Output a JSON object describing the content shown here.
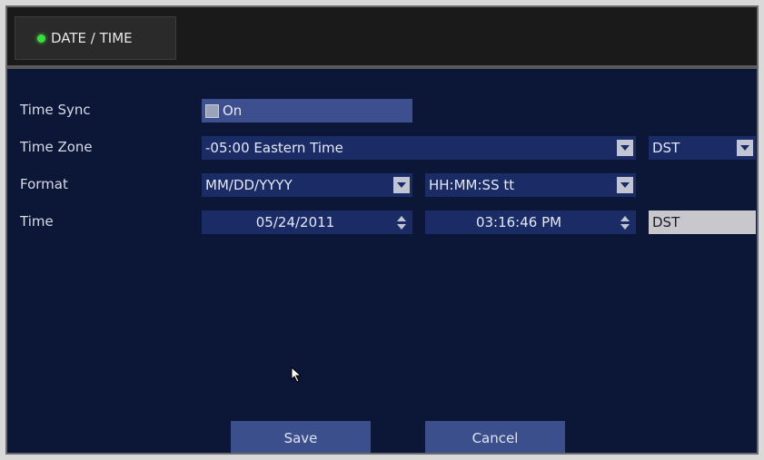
{
  "header": {
    "title": "DATE / TIME",
    "status_color": "#3ddc3d"
  },
  "rows": {
    "time_sync": {
      "label": "Time Sync",
      "checkbox_icon": "checkbox-icon",
      "value": "On"
    },
    "time_zone": {
      "label": "Time Zone",
      "value": "-05:00 Eastern Time",
      "dst_value": "DST"
    },
    "format": {
      "label": "Format",
      "date_format": "MM/DD/YYYY",
      "time_format": "HH:MM:SS tt"
    },
    "time": {
      "label": "Time",
      "date": "05/24/2011",
      "time": "03:16:46 PM",
      "dst_indicator": "DST"
    }
  },
  "buttons": {
    "save": "Save",
    "cancel": "Cancel"
  },
  "colors": {
    "background": "#0c1637",
    "field": "#1b2b66",
    "button": "#3b4f8d"
  }
}
